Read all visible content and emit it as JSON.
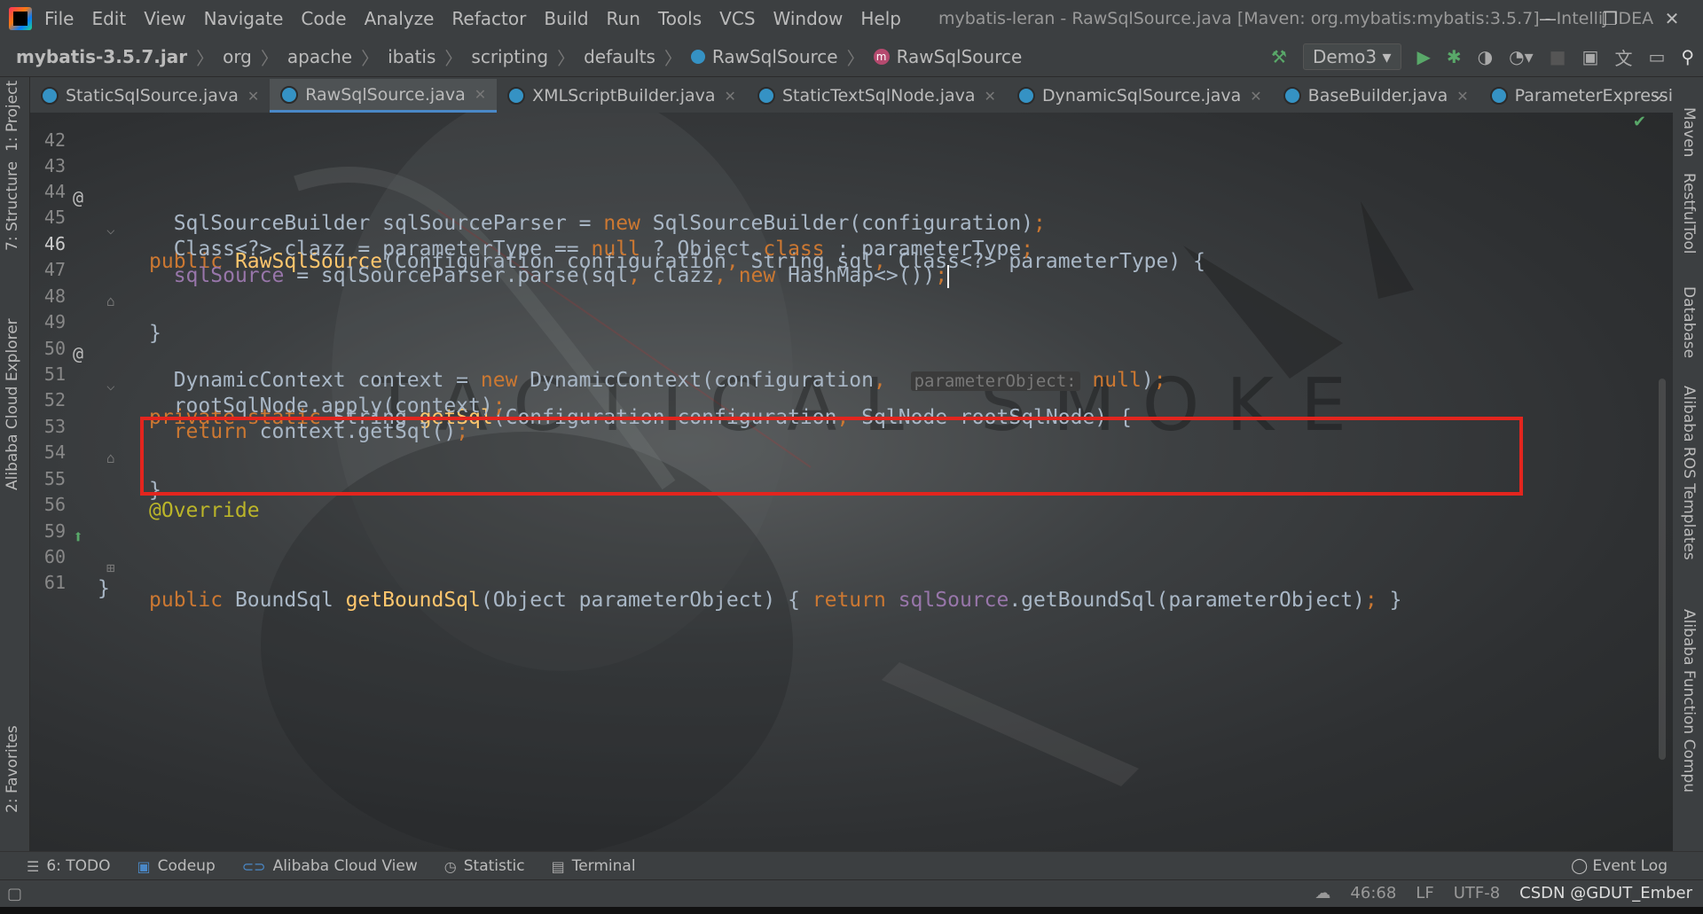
{
  "menubar": {
    "items": [
      "File",
      "Edit",
      "View",
      "Navigate",
      "Code",
      "Analyze",
      "Refactor",
      "Build",
      "Run",
      "Tools",
      "VCS",
      "Window",
      "Help"
    ],
    "window_title": "mybatis-leran - RawSqlSource.java [Maven: org.mybatis:mybatis:3.5.7] - IntelliJ IDEA",
    "controls": {
      "minimize": "—",
      "restore": "❐",
      "close": "✕"
    }
  },
  "breadcrumb": {
    "items": [
      "mybatis-3.5.7.jar",
      "org",
      "apache",
      "ibatis",
      "scripting",
      "defaults",
      "RawSqlSource",
      "RawSqlSource"
    ]
  },
  "toolbar": {
    "run_config": "Demo3"
  },
  "tabs": [
    {
      "label": "StaticSqlSource.java",
      "active": false
    },
    {
      "label": "RawSqlSource.java",
      "active": true
    },
    {
      "label": "XMLScriptBuilder.java",
      "active": false
    },
    {
      "label": "StaticTextSqlNode.java",
      "active": false
    },
    {
      "label": "DynamicSqlSource.java",
      "active": false
    },
    {
      "label": "BaseBuilder.java",
      "active": false
    },
    {
      "label": "ParameterExpression.java",
      "active": false
    }
  ],
  "left_tools": [
    "1: Project",
    "7: Structure",
    "Alibaba Cloud Explorer",
    "2: Favorites"
  ],
  "right_tools": [
    "Maven",
    "RestfulTool",
    "Database",
    "Alibaba ROS Templates",
    "Alibaba Function Compu"
  ],
  "editor": {
    "line_numbers": [
      "42",
      "43",
      "44",
      "45",
      "46",
      "47",
      "48",
      "49",
      "50",
      "51",
      "52",
      "53",
      "54",
      "55",
      "56",
      "59",
      "60",
      "61"
    ],
    "watermark": "TACTICAL SMOKE",
    "param_hint": "parameterObject:"
  },
  "bottom_tools": [
    {
      "label": "6: TODO"
    },
    {
      "label": "Codeup"
    },
    {
      "label": "Alibaba Cloud View"
    },
    {
      "label": "Statistic"
    },
    {
      "label": "Terminal"
    }
  ],
  "event_log": "Event Log",
  "status": {
    "position": "46:68",
    "line_sep": "LF",
    "encoding": "UTF-8",
    "credit": "CSDN @GDUT_Ember"
  },
  "colors": {
    "keyword": "#cc7832",
    "method": "#ffc66d",
    "field": "#9876aa",
    "annotation": "#bbb529",
    "text": "#a9b7c6",
    "highlight": "#e3251e"
  }
}
